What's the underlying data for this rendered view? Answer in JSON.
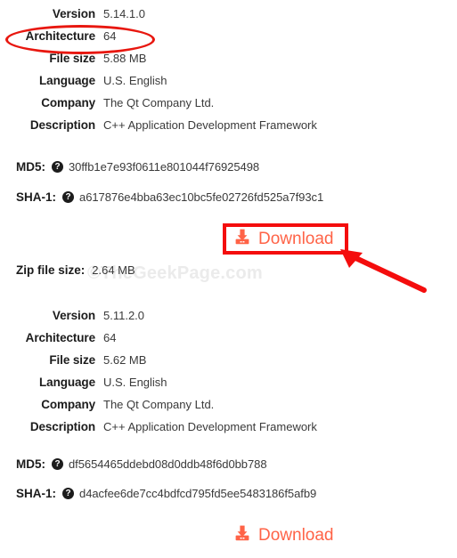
{
  "page": {
    "watermark": "©TheGeekPage.com"
  },
  "packages": [
    {
      "properties": [
        {
          "label": "Version",
          "value": "5.14.1.0"
        },
        {
          "label": "Architecture",
          "value": "64"
        },
        {
          "label": "File size",
          "value": "5.88 MB"
        },
        {
          "label": "Language",
          "value": "U.S. English"
        },
        {
          "label": "Company",
          "value": "The Qt Company Ltd."
        },
        {
          "label": "Description",
          "value": "C++ Application Development Framework"
        }
      ],
      "md5": {
        "label": "MD5:",
        "help": "?",
        "value": "30ffb1e7e93f0611e801044f76925498"
      },
      "sha1": {
        "label": "SHA-1:",
        "help": "?",
        "value": "a617876e4bba63ec10bc5fe02726fd525a7f93c1"
      },
      "download": {
        "label": "Download",
        "icon": "download-icon",
        "color": "#ff6347"
      }
    },
    {
      "zip_file_size": {
        "label": "Zip file size:",
        "value": "2.64 MB"
      },
      "properties": [
        {
          "label": "Version",
          "value": "5.11.2.0"
        },
        {
          "label": "Architecture",
          "value": "64"
        },
        {
          "label": "File size",
          "value": "5.62 MB"
        },
        {
          "label": "Language",
          "value": "U.S. English"
        },
        {
          "label": "Company",
          "value": "The Qt Company Ltd."
        },
        {
          "label": "Description",
          "value": "C++ Application Development Framework"
        }
      ],
      "md5": {
        "label": "MD5:",
        "help": "?",
        "value": "df5654465ddebd08d0ddb48f6d0bb788"
      },
      "sha1": {
        "label": "SHA-1:",
        "help": "?",
        "value": "d4acfee6de7cc4bdfcd795fd5ee5483186f5afb9"
      },
      "download": {
        "label": "Download",
        "icon": "download-icon",
        "color": "#ff6347"
      }
    }
  ],
  "annotations": {
    "ellipse_color": "#e8170f",
    "rect_color": "#f40d0d",
    "arrow_color": "#f40d0d"
  }
}
